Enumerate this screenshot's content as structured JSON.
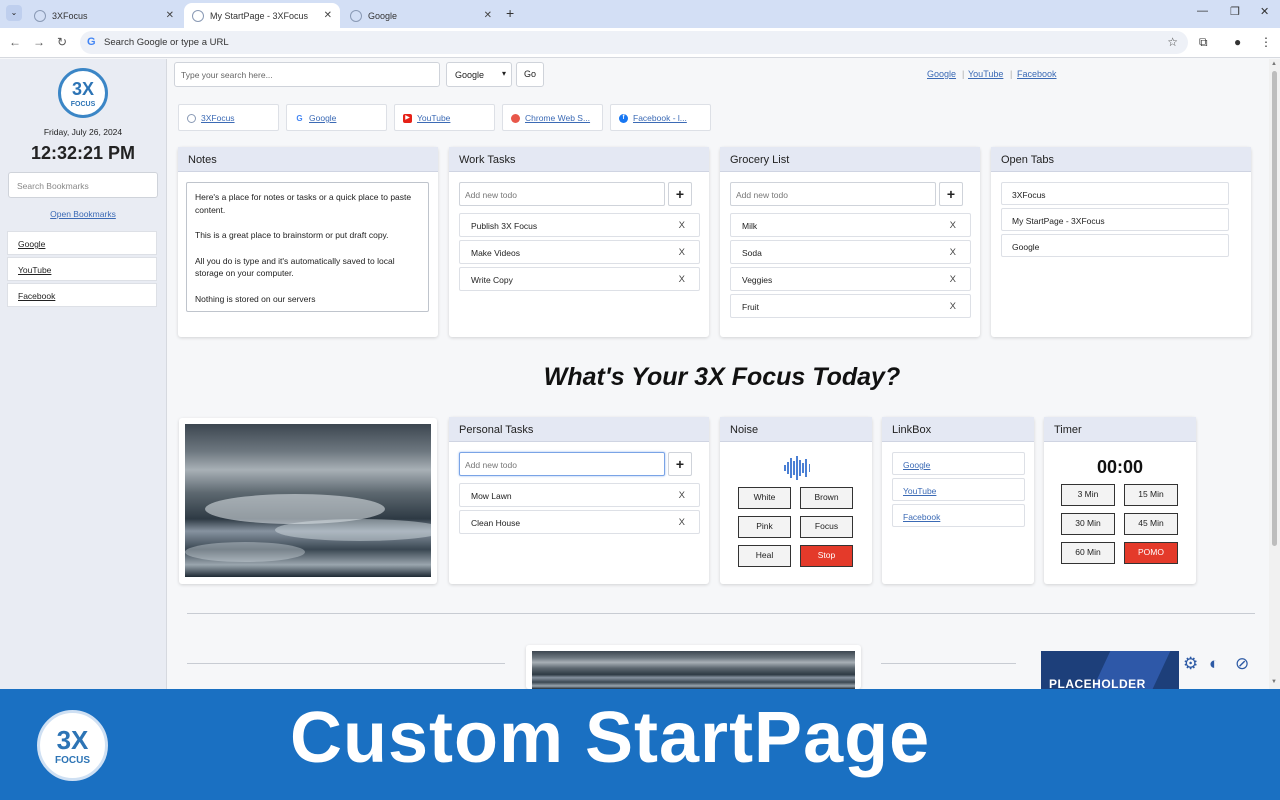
{
  "browser": {
    "tabs": [
      {
        "title": "3XFocus"
      },
      {
        "title": "My StartPage - 3XFocus"
      },
      {
        "title": "Google"
      }
    ],
    "omnibox_placeholder": "Search Google or type a URL"
  },
  "sidebar": {
    "date": "Friday, July 26, 2024",
    "time": "12:32:21 PM",
    "search_placeholder": "Search Bookmarks",
    "open_bookmarks": "Open Bookmarks",
    "links": [
      "Google",
      "YouTube",
      "Facebook"
    ]
  },
  "top": {
    "search_placeholder": "Type your search here...",
    "engine": "Google",
    "go": "Go",
    "links": [
      "Google",
      "YouTube",
      "Facebook"
    ]
  },
  "bookmarks": [
    "3XFocus",
    "Google",
    "YouTube",
    "Chrome Web S...",
    "Facebook - l..."
  ],
  "notes": {
    "title": "Notes",
    "paragraphs": [
      "Here's a place for notes or tasks or a quick place to paste content.",
      "This is a great place to brainstorm or put draft copy.",
      "All you do is type and it's automatically saved to local storage on your computer.",
      "Nothing is stored on our servers"
    ]
  },
  "work_tasks": {
    "title": "Work Tasks",
    "placeholder": "Add new todo",
    "items": [
      "Publish 3X Focus",
      "Make Videos",
      "Write Copy"
    ]
  },
  "grocery": {
    "title": "Grocery List",
    "placeholder": "Add new todo",
    "items": [
      "Milk",
      "Soda",
      "Veggies",
      "Fruit"
    ]
  },
  "open_tabs": {
    "title": "Open Tabs",
    "items": [
      "3XFocus",
      "My StartPage - 3XFocus",
      "Google"
    ]
  },
  "headline": "What's Your 3X Focus Today?",
  "personal": {
    "title": "Personal Tasks",
    "placeholder": "Add new todo",
    "items": [
      "Mow Lawn",
      "Clean House"
    ]
  },
  "noise": {
    "title": "Noise",
    "buttons": [
      "White",
      "Brown",
      "Pink",
      "Focus",
      "Heal",
      "Stop"
    ]
  },
  "linkbox": {
    "title": "LinkBox",
    "items": [
      "Google",
      "YouTube",
      "Facebook"
    ]
  },
  "timer": {
    "title": "Timer",
    "display": "00:00",
    "buttons": [
      "3 Min",
      "15 Min",
      "30 Min",
      "45 Min",
      "60 Min",
      "POMO"
    ]
  },
  "todo_delete": "X",
  "plus": "+",
  "placeholder_card": "PLACEHOLDER",
  "logo": {
    "big": "3X",
    "small": "FOCUS"
  },
  "banner": {
    "title": "Custom StartPage"
  },
  "colors": {
    "accent_blue": "#1a70c2",
    "stop_red": "#e43a2a",
    "link": "#3b6ab5"
  }
}
